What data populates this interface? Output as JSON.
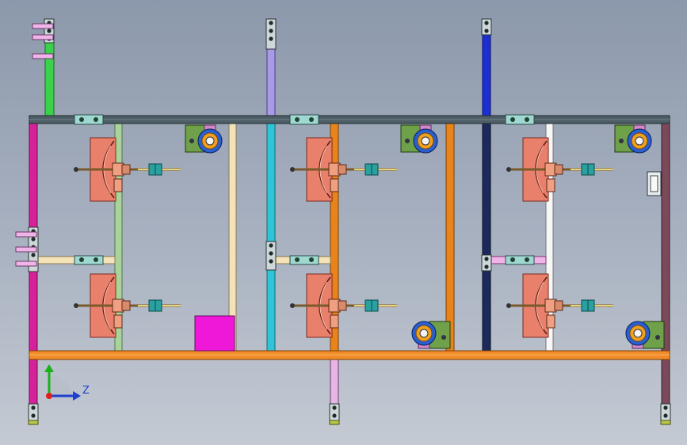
{
  "view": {
    "type": "cad-orthographic-assembly",
    "background": "#9aa5b8"
  },
  "triad": {
    "labels": {
      "z": "Z"
    },
    "colors": {
      "x": "#e02020",
      "y": "#19b219",
      "z": "#1f3fcf"
    }
  },
  "colors": {
    "frame_dark": "#4d5e66",
    "frame_bottom": "#f28c28",
    "left_post": "#d6229a",
    "right_post": "#7a4a5a",
    "green_post": "#3bd14a",
    "lavender_post": "#a99ae6",
    "cyan_post": "#31c4d6",
    "orange_post": "#e8841a",
    "blue_post": "#1d2fd0",
    "navy_post": "#1b2a5a",
    "pale_green_post": "#a9d39a",
    "cream_post": "#f4e3b8",
    "salmon_fan": "#e9806c",
    "motor_box": "#6fa04a",
    "roller_ring": "#f0a020",
    "roller_outer": "#2a5fd0",
    "magenta_block": "#f018d8"
  },
  "units": {
    "fan_assemblies": 6,
    "motor_roller_units": 6
  }
}
